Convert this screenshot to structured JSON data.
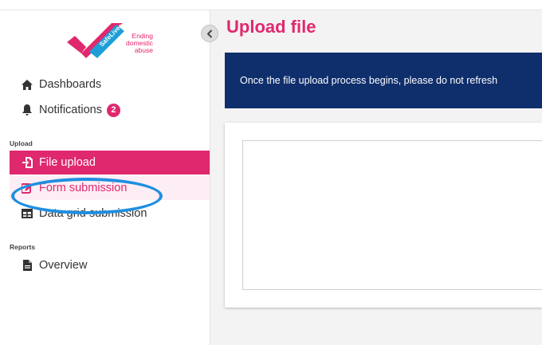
{
  "brand": {
    "logo_mark_text": "SafeLives",
    "tagline_line1": "Ending",
    "tagline_line2": "domestic",
    "tagline_line3": "abuse",
    "primary_color": "#e0286e",
    "banner_color": "#0f2e6c"
  },
  "sidebar": {
    "items": [
      {
        "label": "Dashboards",
        "icon": "home-icon"
      },
      {
        "label": "Notifications",
        "icon": "bell-icon",
        "badge": "2"
      }
    ],
    "sections": [
      {
        "label": "Upload",
        "items": [
          {
            "label": "File upload",
            "icon": "file-import-icon",
            "state": "active"
          },
          {
            "label": "Form submission",
            "icon": "edit-icon",
            "state": "highlighted"
          },
          {
            "label": "Data grid submission",
            "icon": "table-icon"
          }
        ]
      },
      {
        "label": "Reports",
        "items": [
          {
            "label": "Overview",
            "icon": "document-icon"
          }
        ]
      }
    ]
  },
  "main": {
    "title": "Upload file",
    "banner_text": "Once the file upload process begins, please do not refresh"
  }
}
